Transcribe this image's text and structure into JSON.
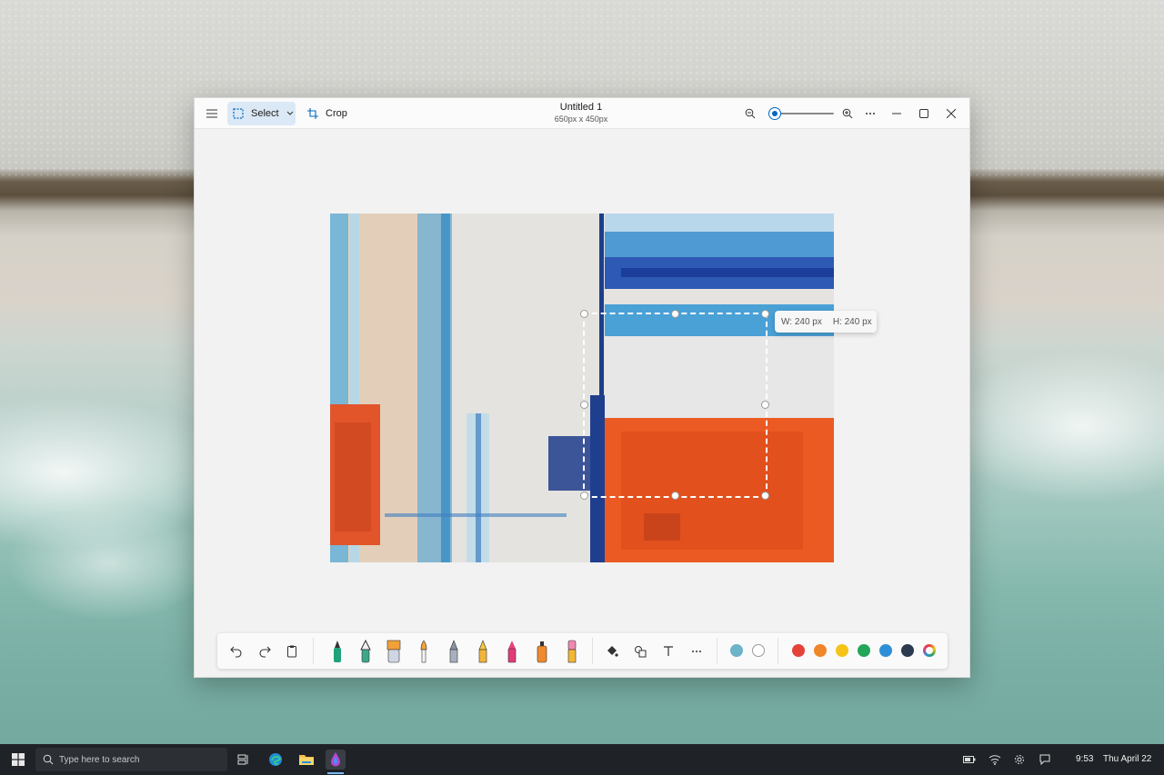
{
  "window": {
    "title": "Untitled 1",
    "subtitle": "650px x 450px",
    "select_label": "Select",
    "crop_label": "Crop",
    "zoom_level": 0.1
  },
  "selection": {
    "width_label": "W: 240 px",
    "height_label": "H: 240 px"
  },
  "toolbar": {
    "history_tools": [
      "undo-icon",
      "redo-icon",
      "clipboard-icon"
    ],
    "brushes": [
      "marker-green",
      "fountain-pen",
      "broad-brush",
      "paint-brush",
      "pencil-gray",
      "pencil-yellow",
      "crayon-pink",
      "spray-orange",
      "eraser"
    ],
    "tools": [
      "fill-icon",
      "shapes-icon",
      "text-icon",
      "more-icon"
    ],
    "active_colors": [
      "#6db3c9",
      "#ffffff"
    ],
    "palette": [
      "#e5423a",
      "#f0862a",
      "#f5c316",
      "#23a65a",
      "#2f8fd6",
      "#2b3a4f"
    ]
  },
  "taskbar": {
    "search_placeholder": "Type here to search",
    "time": "9:53",
    "date": "Thu April 22"
  }
}
